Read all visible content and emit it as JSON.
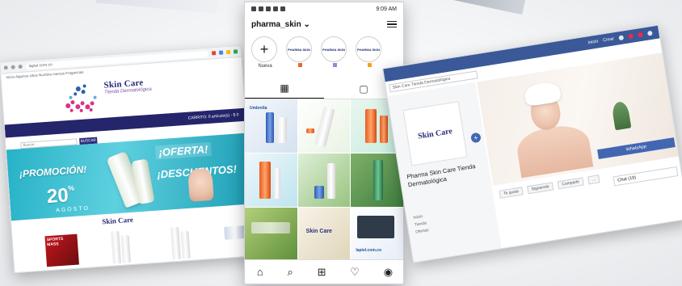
{
  "left_site": {
    "url": "lapiel.com.co",
    "bookmarks": "Inicio  Algunos sitios  Nombre marcas  Fragancias",
    "brand": "Skin Care",
    "subtitle": "Tienda Dermatológica",
    "cart": "CARRITO: 0 artículo(s) - $ 0",
    "search_placeholder": "Buscar...",
    "search_button": "BUSCAR",
    "banner": {
      "promo": "¡PROMOCIÓN!",
      "percent": "20",
      "percent_sign": "%",
      "month": "AGOSTO",
      "offer": "¡OFERTA!",
      "discounts": "¡DESCUENTOS!"
    },
    "brand_repeat": "Skin Care",
    "product_box_label": "SPORTS MASS"
  },
  "instagram": {
    "time": "9:09 AM",
    "username": "pharma_skin",
    "username_caret": "⌄",
    "stories": [
      {
        "label": "Nueva"
      },
      {
        "label": ""
      },
      {
        "label": ""
      },
      {
        "label": ""
      }
    ],
    "story_logo": "PHARMA SKIN",
    "grid_tab_icon": "grid-icon",
    "tagged_tab_icon": "tagged-icon",
    "tile_texts": [
      "Umbrella",
      "Skin Care",
      "lapiel.com.co"
    ],
    "bottom_nav": [
      "home-icon",
      "search-icon",
      "add-icon",
      "heart-icon",
      "profile-icon"
    ]
  },
  "facebook": {
    "search": "Skin Care Tienda Dermatológica",
    "top_links": [
      "Inicio",
      "Crear"
    ],
    "profile_brand": "Skin Care",
    "page_name": "Pharma Skin Care Tienda Dermatológica",
    "left_links": [
      "Inicio",
      "Tienda",
      "Ofertas"
    ],
    "actions": [
      "Te gusta",
      "Siguiendo",
      "Compartir",
      "..."
    ],
    "whatsapp": "WhatsApp",
    "chat": "Chat (19)",
    "accent": "#3b5998"
  }
}
